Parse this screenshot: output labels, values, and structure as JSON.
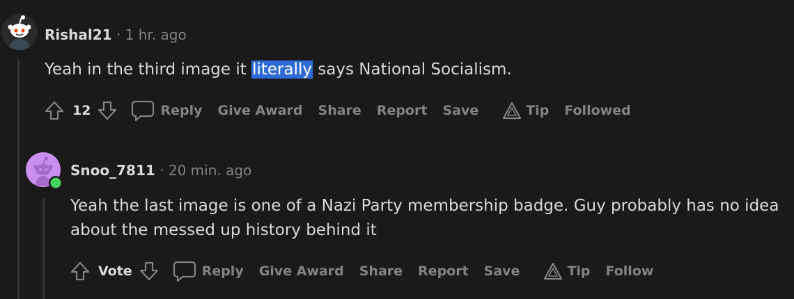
{
  "comments": [
    {
      "author": "Rishal21",
      "separator": "·",
      "time": "1 hr. ago",
      "text_before": "Yeah in the third image it ",
      "text_highlight": "literally",
      "text_after": " says National Socialism.",
      "score": "12",
      "avatar_icon": "snoo-avatar-icon",
      "actions": {
        "reply": "Reply",
        "give_award": "Give Award",
        "share": "Share",
        "report": "Report",
        "save": "Save",
        "tip": "Tip",
        "follow": "Followed"
      }
    },
    {
      "author": "Snoo_7811",
      "separator": "·",
      "time": "20 min. ago",
      "text": "Yeah the last image is one of a Nazi Party membership badge. Guy probably has no idea about the messed up history behind it",
      "score": "Vote",
      "avatar_icon": "snoo-default-avatar-icon",
      "online_status": "online",
      "actions": {
        "reply": "Reply",
        "give_award": "Give Award",
        "share": "Share",
        "report": "Report",
        "save": "Save",
        "tip": "Tip",
        "follow": "Follow"
      }
    }
  ],
  "colors": {
    "background": "#1a1a1b",
    "text": "#d7dadc",
    "muted": "#818384",
    "highlight": "#2f6bd6",
    "online": "#46d160",
    "avatar_bg": "#c98ef0"
  }
}
